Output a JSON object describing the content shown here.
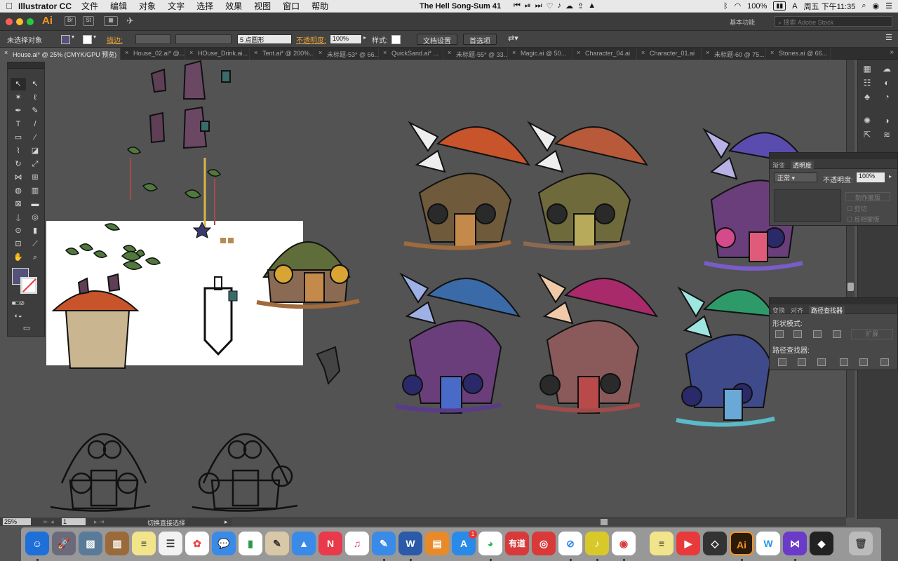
{
  "menubar": {
    "apple": "",
    "app_name": "Illustrator CC",
    "items": [
      "文件",
      "编辑",
      "对象",
      "文字",
      "选择",
      "效果",
      "视图",
      "窗口",
      "帮助"
    ],
    "now_playing": "The Hell Song-Sum 41",
    "battery": "100%",
    "clock": "周五 下午11:35"
  },
  "appbar": {
    "logo": "Ai",
    "workspace": "基本功能",
    "search_placeholder": "搜索 Adobe Stock"
  },
  "controlbar": {
    "selection": "未选择对象",
    "stroke_label": "描边:",
    "brush": "5 点圆形",
    "opacity_label": "不透明度:",
    "opacity_value": "100%",
    "style_label": "样式:",
    "doc_setup": "文档设置",
    "prefs": "首选项",
    "colors": {
      "fill": "#54517a"
    }
  },
  "tabs": [
    "House.ai* @ 25% (CMYK/GPU 预览)",
    "House_02.ai* @...",
    "HOuse_Drink.ai...",
    "Tent.ai* @ 200%...",
    "未标题-53* @ 66...",
    "QuickSand.ai* ...",
    "未标题-55* @ 33...",
    "Magic.ai @ 50...",
    "Character_04.ai",
    "Character_01.ai",
    "未标题-60 @ 75...",
    "Stones.ai @ 66..."
  ],
  "statusbar": {
    "zoom": "25%",
    "page": "1",
    "tool_hint": "切换直接选择"
  },
  "transparency_panel": {
    "tabs": [
      "渐变",
      "透明度"
    ],
    "mode": "正常",
    "opacity_label": "不透明度:",
    "opacity_value": "100%",
    "make_mask": "制作蒙版",
    "clip": "剪切",
    "invert": "反相蒙版"
  },
  "pathfinder_panel": {
    "tabs": [
      "变换",
      "对齐",
      "路径查找器"
    ],
    "shape_modes": "形状模式:",
    "expand": "扩展",
    "pathfinders": "路径查找器:"
  },
  "dock": {
    "badge": "1",
    "netease_label": "有道",
    "word_label": "W",
    "ai_label": "Ai"
  }
}
